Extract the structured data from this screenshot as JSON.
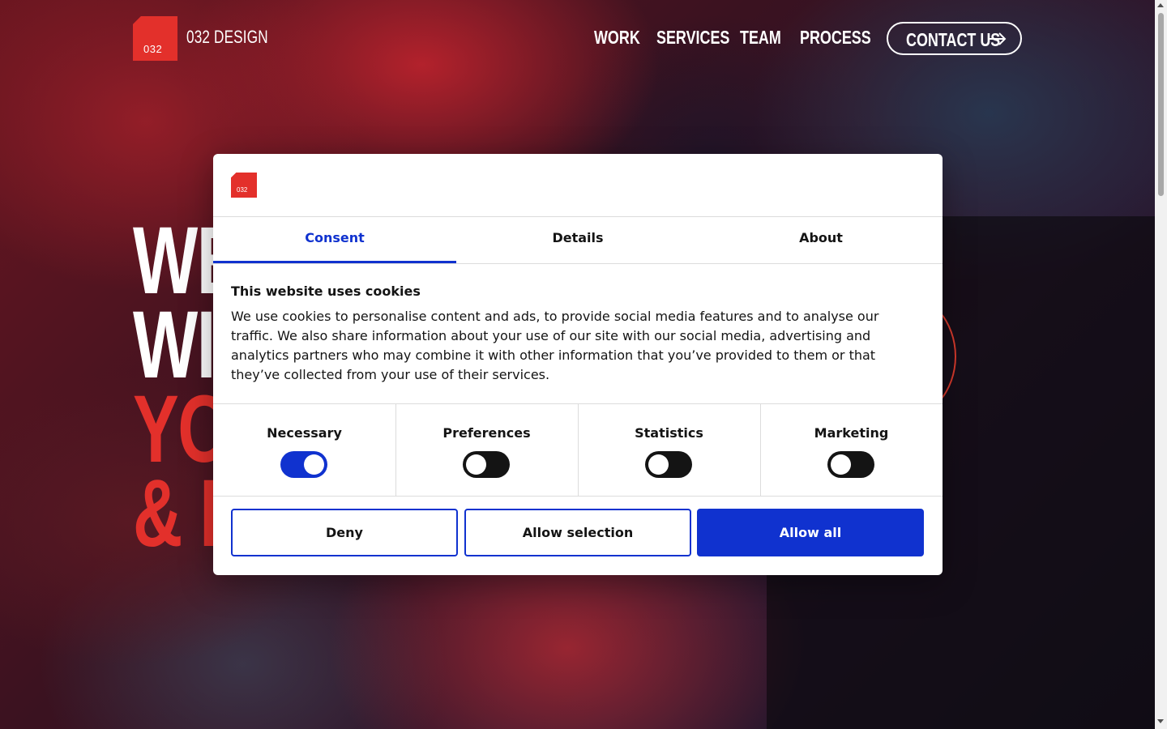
{
  "header": {
    "logo_text": "032",
    "brand": "032 DESIGN",
    "nav": [
      "WORK",
      "SERVICES",
      "TEAM",
      "PROCESS"
    ],
    "contact_label": "CONTACT US"
  },
  "hero": {
    "lines": [
      "WE",
      "WIT",
      "YO",
      "& L"
    ]
  },
  "cookie_dialog": {
    "logo_text": "032",
    "tabs": [
      "Consent",
      "Details",
      "About"
    ],
    "active_tab": "Consent",
    "title": "This website uses cookies",
    "body": "We use cookies to personalise content and ads, to provide social media features and to analyse our traffic. We also share information about your use of our site with our social media, advertising and analytics partners who may combine it with other information that you’ve provided to them or that they’ve collected from your use of their services.",
    "categories": [
      {
        "label": "Necessary",
        "checked": true
      },
      {
        "label": "Preferences",
        "checked": false
      },
      {
        "label": "Statistics",
        "checked": false
      },
      {
        "label": "Marketing",
        "checked": false
      }
    ],
    "buttons": {
      "deny": "Deny",
      "allow_selection": "Allow selection",
      "allow_all": "Allow all"
    }
  },
  "colors": {
    "brand_red": "#e3302b",
    "accent_blue": "#1032cf"
  }
}
